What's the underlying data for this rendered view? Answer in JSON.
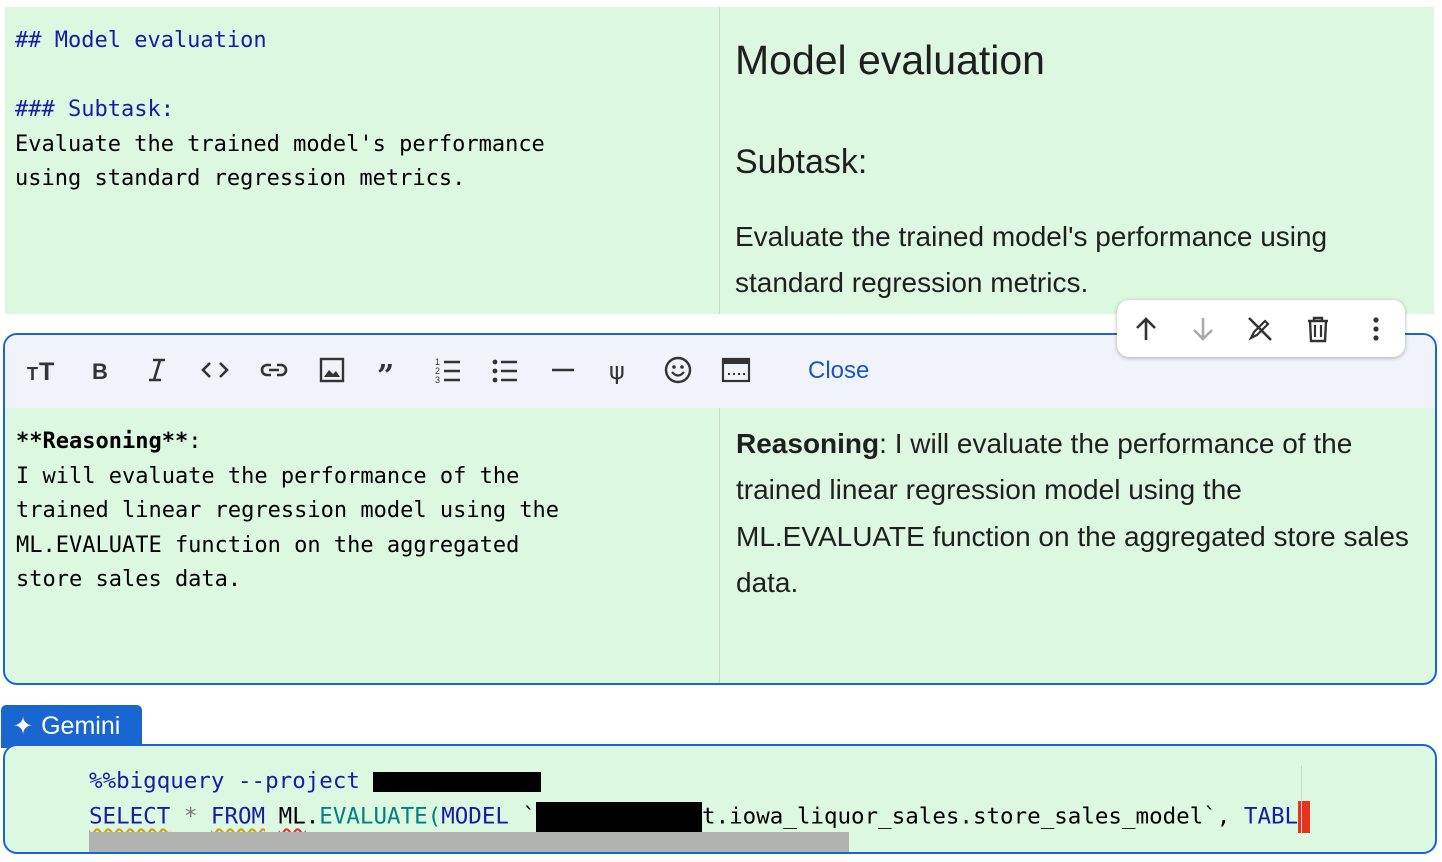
{
  "cell1": {
    "source": {
      "h2": "## Model evaluation",
      "h3": "### Subtask:",
      "line1": "Evaluate the trained model's performance",
      "line2": "using standard regression metrics."
    },
    "rendered": {
      "title": "Model evaluation",
      "subtitle": "Subtask:",
      "body": "Evaluate the trained model's performance using standard regression metrics."
    }
  },
  "cell_actions": {
    "icons": [
      "arrow-up-icon",
      "arrow-down-icon",
      "no-edit-icon",
      "trash-icon",
      "more-vert-icon"
    ]
  },
  "editor_toolbar": {
    "icons": [
      "text-size-icon",
      "bold-icon",
      "italic-icon",
      "code-icon",
      "link-icon",
      "image-icon",
      "quote-icon",
      "numbered-list-icon",
      "bullet-list-icon",
      "horizontal-rule-icon",
      "psi-icon",
      "emoji-icon",
      "terminal-icon"
    ],
    "close_label": "Close"
  },
  "cell2": {
    "source": {
      "bold": "**Reasoning**",
      "colon": ":",
      "line1": "I will evaluate the performance of the",
      "line2": "trained linear regression model using the",
      "line3": "ML.EVALUATE function on the aggregated",
      "line4": "store sales data."
    },
    "rendered": {
      "bold": "Reasoning",
      "text": ": I will evaluate the performance of the trained linear regression model using the ML.EVALUATE function on the aggregated store sales data."
    }
  },
  "gemini": {
    "label": "Gemini"
  },
  "code_cell": {
    "line1": {
      "magic": "%%bigquery --project"
    },
    "line2": {
      "select": "SELECT",
      "star": "*",
      "from": "FROM",
      "ml": "ML",
      "dot": ".",
      "evaluate": "EVALUATE(",
      "model": "MODEL",
      "tick": " `",
      "rest": "t.iowa_liquor_sales.store_sales_model`, ",
      "table": "TABL"
    }
  },
  "colors": {
    "cell_bg": "#dcf8e1",
    "accent": "#1a66d0",
    "cursor": "#e8341c",
    "toolbar_bg": "#f0f4fa"
  }
}
